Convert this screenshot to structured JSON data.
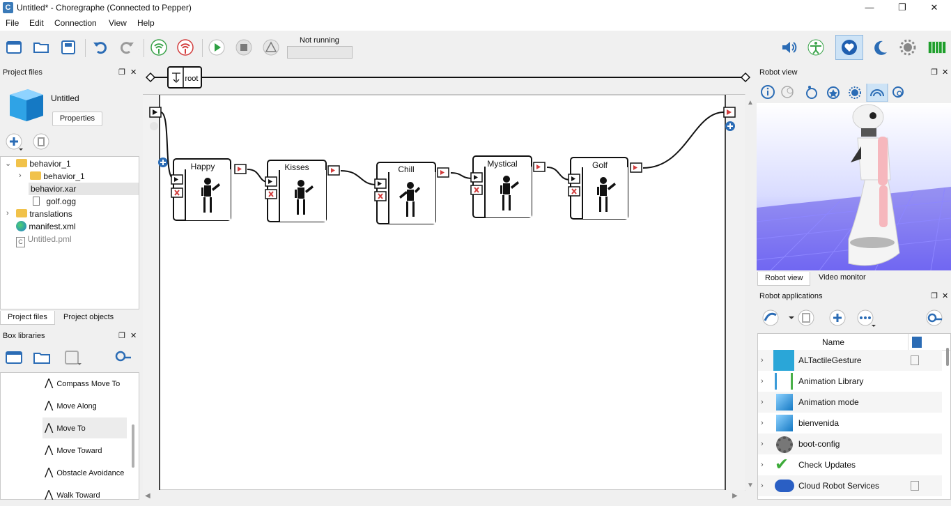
{
  "window": {
    "title": "Untitled* - Choregraphe (Connected to Pepper)",
    "app_icon": "C",
    "controls": [
      "minimize-icon",
      "restore-icon",
      "close-icon"
    ]
  },
  "menu": [
    "File",
    "Edit",
    "Connection",
    "View",
    "Help"
  ],
  "toolbar": {
    "left_icons": [
      "new-project-icon",
      "open-project-icon",
      "save-project-icon",
      "undo-icon",
      "redo-icon",
      "connect-icon",
      "disconnect-icon",
      "play-icon",
      "stop-icon",
      "debug-icon"
    ],
    "status": "Not running",
    "right_icons": [
      "volume-icon",
      "animation-mode-icon",
      "autonomous-life-icon",
      "sleep-icon",
      "settings-icon",
      "battery-icon"
    ],
    "battery_level": 1.0
  },
  "project_files": {
    "title": "Project files",
    "project_name": "Untitled",
    "properties_label": "Properties",
    "tree": [
      {
        "label": "behavior_1",
        "type": "folder",
        "expanded": true
      },
      {
        "label": "behavior_1",
        "type": "folder",
        "expanded": false
      },
      {
        "label": "behavior.xar",
        "type": "file"
      },
      {
        "label": "golf.ogg",
        "type": "file"
      },
      {
        "label": "translations",
        "type": "folder",
        "expanded": false
      },
      {
        "label": "manifest.xml",
        "type": "file"
      },
      {
        "label": "Untitled.pml",
        "type": "file"
      }
    ],
    "tabs": [
      "Project files",
      "Project objects"
    ]
  },
  "box_libraries": {
    "title": "Box libraries",
    "items": [
      "Compass Move To",
      "Move Along",
      "Move To",
      "Move Toward",
      "Obstacle Avoidance",
      "Walk Toward"
    ],
    "selected": "Move To"
  },
  "flow": {
    "breadcrumb": "root",
    "boxes": [
      "Happy",
      "Kisses",
      "Chill",
      "Mystical",
      "Golf"
    ]
  },
  "robot_view": {
    "title": "Robot view",
    "tabs": [
      "Robot view",
      "Video monitor"
    ],
    "colors": {
      "floor": "#5b4fe8",
      "grid": "#8d86ff"
    }
  },
  "robot_applications": {
    "title": "Robot applications",
    "column_name": "Name",
    "apps": [
      {
        "name": "ALTactileGesture",
        "icon": "tactile-icon",
        "flag": true
      },
      {
        "name": "Animation Library",
        "icon": "animation-icon",
        "flag": false
      },
      {
        "name": "Animation mode",
        "icon": "cube-icon",
        "flag": false
      },
      {
        "name": "bienvenida",
        "icon": "cube-icon",
        "flag": false
      },
      {
        "name": "boot-config",
        "icon": "gear-icon",
        "flag": false
      },
      {
        "name": "Check Updates",
        "icon": "check-icon",
        "flag": false
      },
      {
        "name": "Cloud Robot Services",
        "icon": "cloud-icon",
        "flag": true
      }
    ]
  }
}
